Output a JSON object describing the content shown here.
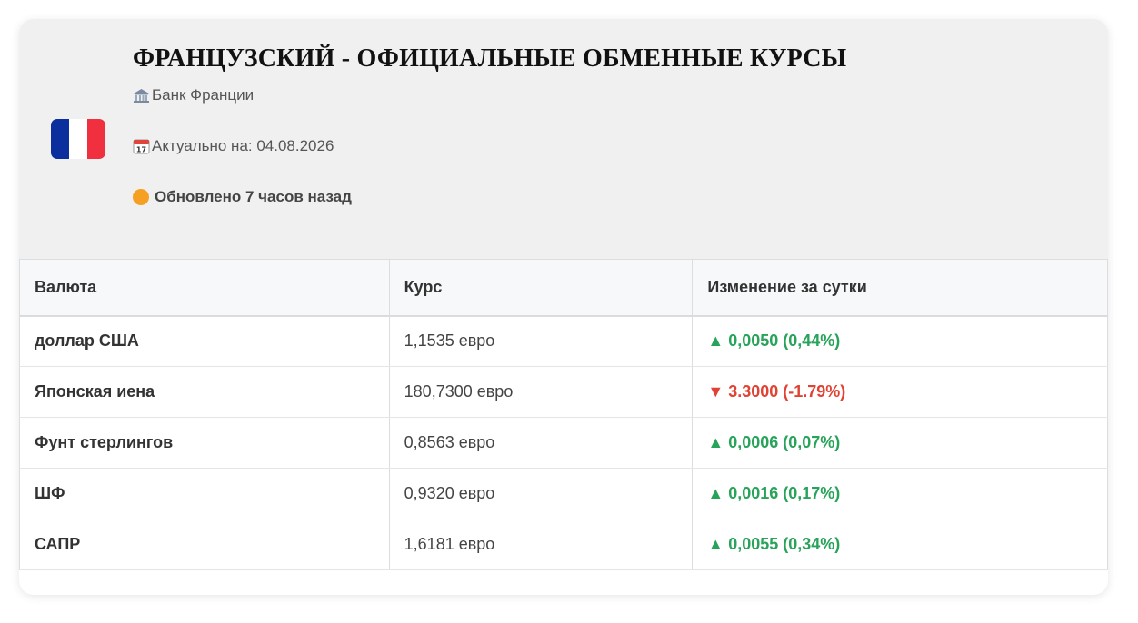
{
  "header": {
    "title": "ФРАНЦУЗСКИЙ - ОФИЦИАЛЬНЫЕ ОБМЕННЫЕ КУРСЫ",
    "bank": "Банк Франции",
    "date_label": "Актуально на: 04.08.2026",
    "updated": "Обновлено 7 часов назад",
    "flag_icon": "france-flag-icon",
    "bank_icon": "bank-icon",
    "calendar_icon": "calendar-icon",
    "status_color": "#f5a023"
  },
  "table": {
    "columns": [
      "Валюта",
      "Курс",
      "Изменение за сутки"
    ],
    "rows": [
      {
        "currency": "доллар США",
        "rate": "1,1535 евро",
        "change": "▲ 0,0050 (0,44%)",
        "direction": "up"
      },
      {
        "currency": "Японская иена",
        "rate": "180,7300 евро",
        "change": "▼ 3.3000 (-1.79%)",
        "direction": "down"
      },
      {
        "currency": "Фунт стерлингов",
        "rate": "0,8563 евро",
        "change": "▲ 0,0006 (0,07%)",
        "direction": "up"
      },
      {
        "currency": "ШФ",
        "rate": "0,9320 евро",
        "change": "▲ 0,0016 (0,17%)",
        "direction": "up"
      },
      {
        "currency": "САПР",
        "rate": "1,6181 евро",
        "change": "▲ 0,0055 (0,34%)",
        "direction": "up"
      }
    ]
  },
  "colors": {
    "up": "#28a35a",
    "down": "#e04333"
  }
}
